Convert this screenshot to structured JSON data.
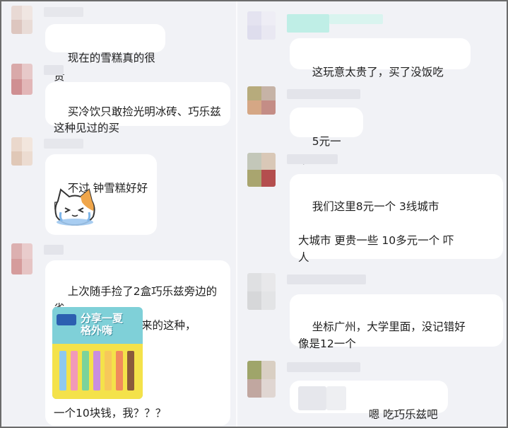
{
  "colors": {
    "background": "#f1f2f6",
    "bubble": "#ffffff",
    "text": "#1f1f1f",
    "pixelated_name": "#e3e4ea"
  },
  "left_column": {
    "messages": [
      {
        "text": "现在的雪糕真的很贵"
      },
      {
        "text": "买冷饮只敢捡光明冰砖、巧乐兹\n这种见过的买"
      },
      {
        "text": "不过 钟雪糕好好吃",
        "sticker": "crying-cat-sticker"
      },
      {
        "text": "上次随手捡了2盒巧乐兹旁边的雀\n巢。用小盒子装起来的这种，",
        "image": "ice-cream-box-photo",
        "image_title": [
          "分享一夏",
          "格外嗨"
        ],
        "caption": "一个10块钱，我？？？"
      }
    ]
  },
  "right_column": {
    "messages": [
      {
        "text": "这玩意太贵了，买了没饭吃"
      },
      {
        "text": "5元一个?"
      },
      {
        "text": "我们这里8元一个 3线城市\n\n大城市 更贵一些 10多元一个 吓\n人"
      },
      {
        "text": "坐标广州，大学里面，没记错好\n像是12一个"
      },
      {
        "text": "嗯 吃巧乐兹吧"
      }
    ]
  }
}
